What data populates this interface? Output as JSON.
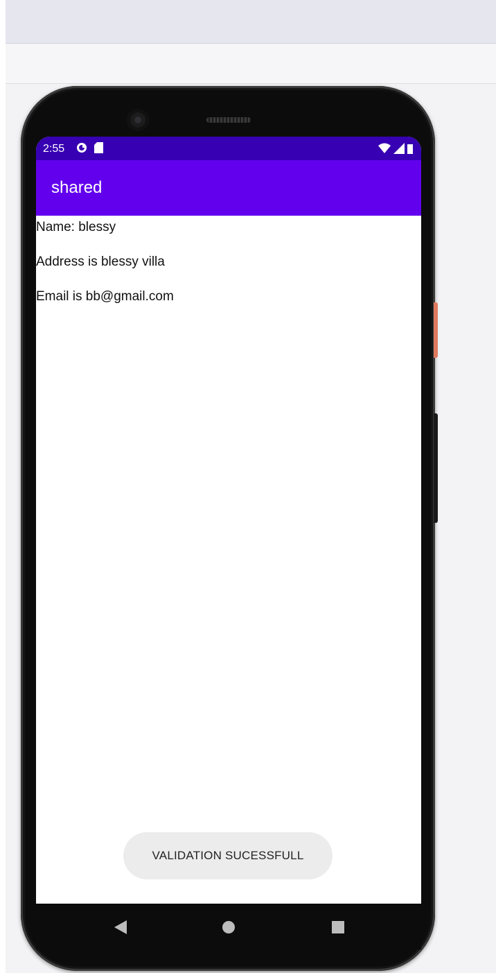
{
  "status_bar": {
    "time": "2:55",
    "left_icons": [
      "sync-icon",
      "sd-card-icon"
    ],
    "right_icons": [
      "wifi-icon",
      "signal-icon",
      "battery-icon"
    ],
    "color": "#3700b3"
  },
  "app_bar": {
    "title": "shared",
    "color": "#6200ee"
  },
  "content": {
    "name_line": "Name: blessy",
    "address_line": "Address is blessy villa",
    "email_line": "Email is bb@gmail.com"
  },
  "toast": {
    "message": "VALIDATION SUCESSFULL"
  },
  "nav_bar": {
    "buttons": [
      "back-icon",
      "home-icon",
      "recents-icon"
    ]
  }
}
